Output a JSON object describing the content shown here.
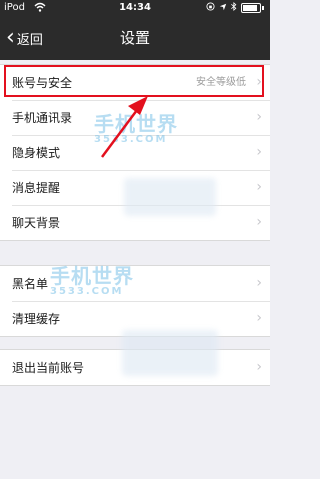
{
  "status_bar": {
    "carrier": "iPod",
    "time": "14:34"
  },
  "nav": {
    "back_label": "返回",
    "title": "设置"
  },
  "groups": [
    {
      "rows": [
        {
          "label": "账号与安全",
          "value": "安全等级低"
        },
        {
          "label": "手机通讯录"
        },
        {
          "label": "隐身模式"
        },
        {
          "label": "消息提醒"
        },
        {
          "label": "聊天背景"
        }
      ]
    },
    {
      "rows": [
        {
          "label": "黑名单"
        },
        {
          "label": "清理缓存"
        }
      ]
    },
    {
      "rows": [
        {
          "label": "退出当前账号"
        }
      ]
    }
  ],
  "watermark": {
    "text": "手机世界",
    "sub": "3533.COM"
  },
  "colors": {
    "nav_bg": "#2b2b2b",
    "highlight": "#e3101e",
    "page_bg": "#efeff4"
  },
  "icons": {
    "back": "chevron-left-icon",
    "row": "chevron-right-icon"
  }
}
